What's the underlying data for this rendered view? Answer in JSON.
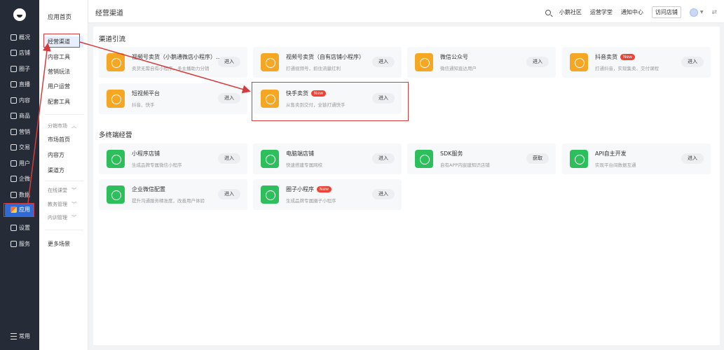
{
  "rail": {
    "items": [
      {
        "label": "概况",
        "icon": "overview-icon"
      },
      {
        "label": "店铺",
        "icon": "store-icon"
      },
      {
        "label": "圈子",
        "icon": "circle-icon"
      },
      {
        "label": "直播",
        "icon": "live-icon"
      },
      {
        "label": "内容",
        "icon": "content-icon"
      },
      {
        "label": "商品",
        "icon": "goods-icon"
      },
      {
        "label": "营销",
        "icon": "marketing-icon"
      },
      {
        "label": "交易",
        "icon": "trade-icon"
      },
      {
        "label": "用户",
        "icon": "user-icon"
      },
      {
        "label": "企微",
        "icon": "wecom-icon"
      },
      {
        "label": "数据",
        "icon": "data-icon"
      },
      {
        "label": "应用",
        "icon": "apps-icon",
        "active": true
      },
      {
        "label": "设置",
        "icon": "settings-icon"
      },
      {
        "label": "服务",
        "icon": "service-icon"
      }
    ],
    "bottom": "常用"
  },
  "subnav": {
    "head": "应用首页",
    "links": [
      "经营渠道",
      "内容工具",
      "营销玩法",
      "用户运营",
      "配套工具"
    ],
    "market_group": "分销市场",
    "market_links": [
      "市场首页",
      "内容方",
      "渠道方"
    ],
    "groups": [
      "在线课堂",
      "教务管理",
      "内训管理"
    ],
    "more": "更多场景"
  },
  "topbar": {
    "title": "经营渠道",
    "links": [
      "小鹅社区",
      "运营学堂",
      "通知中心"
    ],
    "visit": "访问店铺"
  },
  "sections": [
    {
      "title": "渠道引流",
      "cards": [
        {
          "title": "视频号卖货（小鹅通微店小程序）…",
          "desc": "卖货无需自有小程序，多主播助力分销",
          "button": "进入",
          "color": "orange"
        },
        {
          "title": "视频号卖货（自有店铺小程序）",
          "desc": "打通视频号，抓住流量红利",
          "button": "进入",
          "color": "orange"
        },
        {
          "title": "微信公众号",
          "desc": "微信通知直达用户",
          "button": "进入",
          "color": "orange"
        },
        {
          "title": "抖音卖货",
          "badge": "New",
          "desc": "打通抖音，实现集卖、交付课程",
          "button": "进入",
          "color": "orange"
        },
        {
          "title": "短视频平台",
          "desc": "抖音、快手",
          "button": "进入",
          "color": "orange"
        },
        {
          "title": "快手卖货",
          "badge": "New",
          "desc": "从售卖到交付，全链打通快手",
          "button": "进入",
          "color": "orange"
        }
      ]
    },
    {
      "title": "多终端经营",
      "cards": [
        {
          "title": "小程序店铺",
          "desc": "生成品牌专属微信小程序",
          "button": "进入",
          "color": "green"
        },
        {
          "title": "电脑端店铺",
          "desc": "快速搭建专属网校",
          "button": "进入",
          "color": "green"
        },
        {
          "title": "SDK服务",
          "desc": "自有APP内嵌建知识店铺",
          "button": "获取",
          "color": "green"
        },
        {
          "title": "API自主开发",
          "desc": "实现平台间数据互通",
          "button": "进入",
          "color": "green"
        },
        {
          "title": "企业微信配置",
          "desc": "提升沟通服务精准度，改善用户体验",
          "button": "进入",
          "color": "green"
        },
        {
          "title": "圈子小程序",
          "badge": "New",
          "desc": "生成品牌专属圈子小程序",
          "button": "进入",
          "color": "green"
        }
      ]
    }
  ],
  "colors": {
    "accent": "#2e6bd6",
    "orange": "#f5a623",
    "green": "#2cbf5b",
    "annotation": "#d63b3b"
  }
}
